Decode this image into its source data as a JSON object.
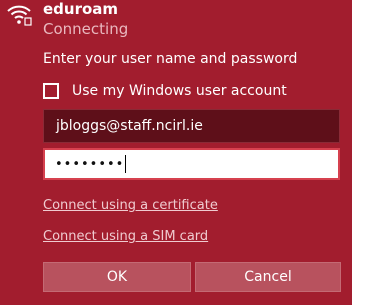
{
  "network": {
    "name": "eduroam",
    "status": "Connecting",
    "icon": "wifi-secured-icon"
  },
  "form": {
    "prompt": "Enter your user name and password",
    "use_windows_account_label": "Use my Windows user account",
    "use_windows_account_checked": false,
    "username_value": "jbloggs@staff.ncirl.ie",
    "password_masked": "••••••••"
  },
  "links": {
    "certificate": "Connect using a certificate",
    "sim_card": "Connect using a SIM card"
  },
  "buttons": {
    "ok": "OK",
    "cancel": "Cancel"
  },
  "colors": {
    "panel_background": "#a21d2e",
    "username_field": "#5e0f19",
    "password_border": "#d6414f",
    "button": "#b8525e"
  }
}
